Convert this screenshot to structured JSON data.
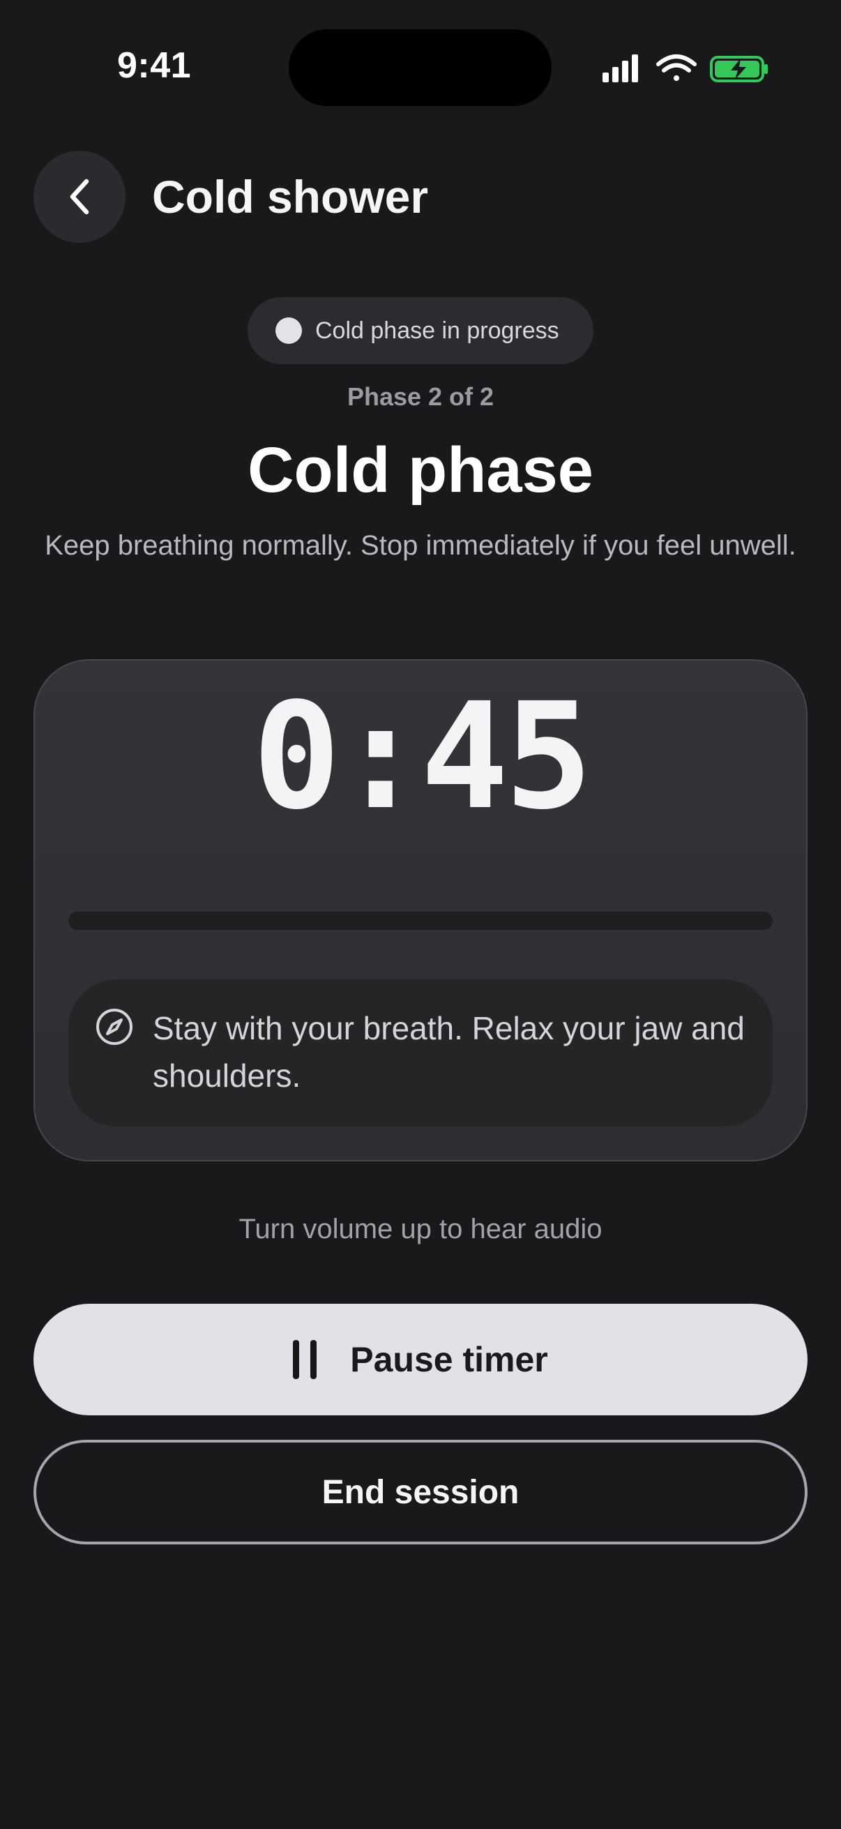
{
  "status_bar": {
    "time": "9:41",
    "icons": [
      "signal-icon",
      "wifi-icon",
      "battery-charging-icon"
    ],
    "battery_color": "#34c759"
  },
  "header": {
    "title": "Cold shower",
    "back_icon": "chevron-left-icon"
  },
  "status_pill": {
    "label": "Cold phase in progress"
  },
  "phase": {
    "counter": "Phase 2 of 2",
    "title": "Cold phase",
    "description": "Keep breathing normally. Stop immediately if you feel unwell."
  },
  "timer": {
    "display": "0:45",
    "progress": 0
  },
  "tip": {
    "icon": "compass-icon",
    "text": "Stay with your breath. Relax your jaw and shoulders."
  },
  "volume_hint": "Turn volume up to hear audio",
  "actions": {
    "pause_label": "Pause timer",
    "pause_icon": "pause-icon",
    "end_label": "End session"
  }
}
